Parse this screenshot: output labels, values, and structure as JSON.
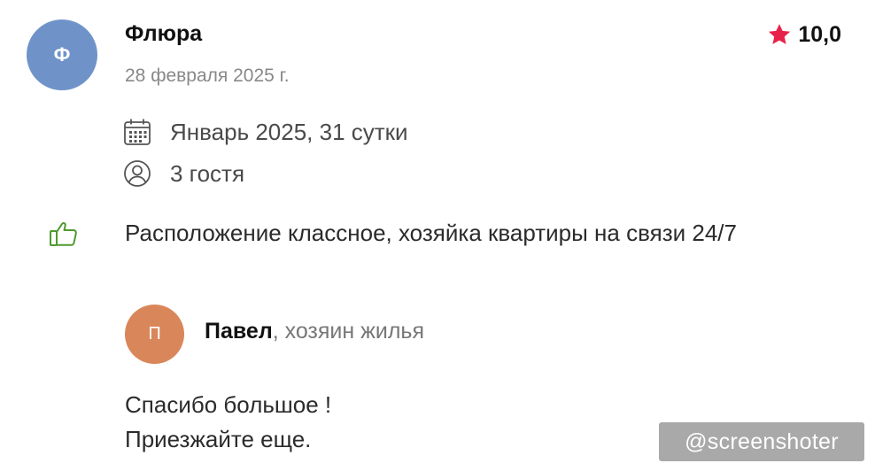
{
  "review": {
    "author_initial": "Ф",
    "author_name": "Флюра",
    "date": "28 февраля 2025 г.",
    "rating": "10,0",
    "stay": "Январь 2025, 31 сутки",
    "guests": "3 гостя",
    "text": "Расположение классное, хозяйка квартиры на связи 24/7"
  },
  "host_reply": {
    "initial": "П",
    "name": "Павел",
    "role": ", хозяин жилья",
    "lines": [
      "Спасибо большое !",
      "Приезжайте еще."
    ]
  },
  "watermark": "@screenshoter",
  "colors": {
    "star": "#e8234a",
    "like_icon": "#4f9a2e",
    "author_avatar": "#6f93c9",
    "host_avatar": "#d9875a"
  }
}
